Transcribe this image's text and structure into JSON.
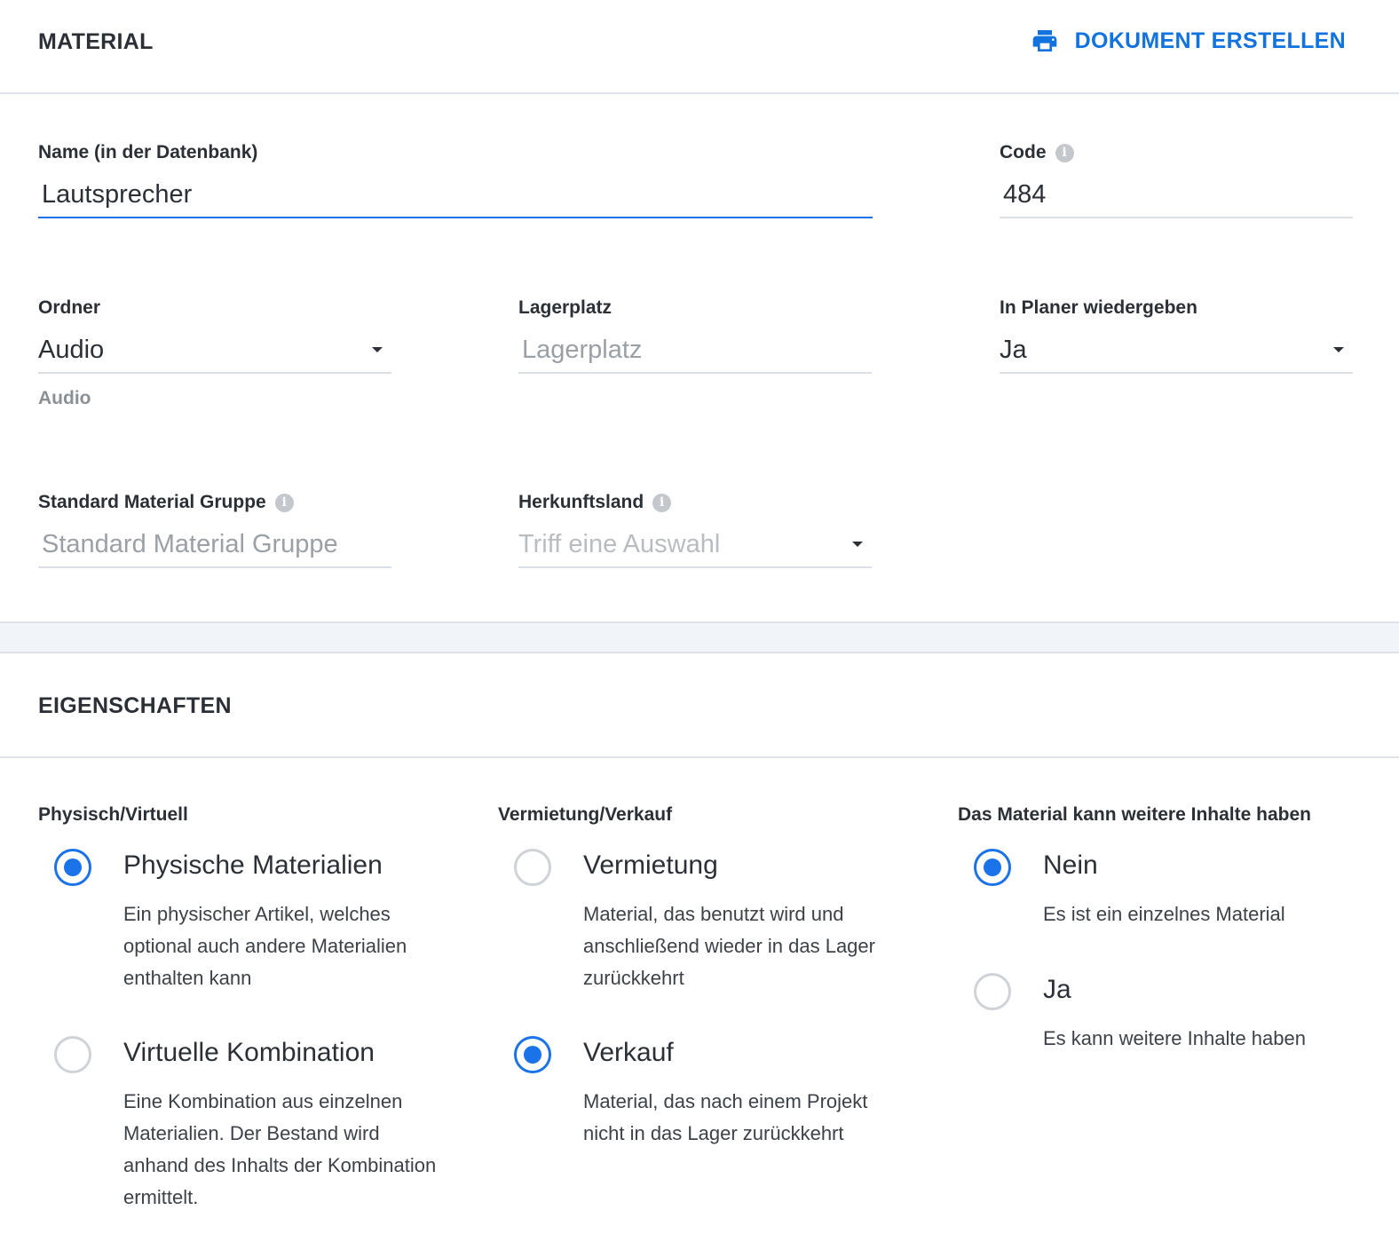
{
  "material": {
    "title": "MATERIAL",
    "doc_button_label": "DOKUMENT ERSTELLEN",
    "doc_button_icon": "printer-icon",
    "accent_color": "#1273de"
  },
  "fields": {
    "name": {
      "label": "Name (in der Datenbank)",
      "value": "Lautsprecher"
    },
    "code": {
      "label": "Code",
      "value": "484",
      "icon": "info-icon"
    },
    "ordner": {
      "label": "Ordner",
      "value": "Audio",
      "helper": "Audio"
    },
    "lagerplatz": {
      "label": "Lagerplatz",
      "placeholder": "Lagerplatz"
    },
    "planer": {
      "label": "In Planer wiedergeben",
      "value": "Ja"
    },
    "gruppe": {
      "label": "Standard Material Gruppe",
      "placeholder": "Standard Material Gruppe",
      "icon": "info-icon"
    },
    "herkunft": {
      "label": "Herkunftsland",
      "placeholder": "Triff eine Auswahl",
      "icon": "info-icon"
    }
  },
  "eigenschaften": {
    "title": "EIGENSCHAFTEN",
    "groups": [
      {
        "label": "Physisch/Virtuell",
        "options": [
          {
            "title": "Physische Materialien",
            "desc": "Ein physischer Artikel, welches optional auch andere Materialien enthalten kann",
            "checked": true
          },
          {
            "title": "Virtuelle Kombination",
            "desc": "Eine Kombination aus einzelnen Materialien. Der Bestand wird anhand des Inhalts der Kombination ermittelt.",
            "checked": false
          }
        ]
      },
      {
        "label": "Vermietung/Verkauf",
        "options": [
          {
            "title": "Vermietung",
            "desc": "Material, das benutzt wird und anschließend wieder in das Lager zurückkehrt",
            "checked": false
          },
          {
            "title": "Verkauf",
            "desc": "Material, das nach einem Projekt nicht in das Lager zurückkehrt",
            "checked": true
          }
        ]
      },
      {
        "label": "Das Material kann weitere Inhalte haben",
        "options": [
          {
            "title": "Nein",
            "desc": "Es ist ein einzelnes Material",
            "checked": true
          },
          {
            "title": "Ja",
            "desc": "Es kann weitere Inhalte haben",
            "checked": false
          }
        ]
      }
    ]
  }
}
